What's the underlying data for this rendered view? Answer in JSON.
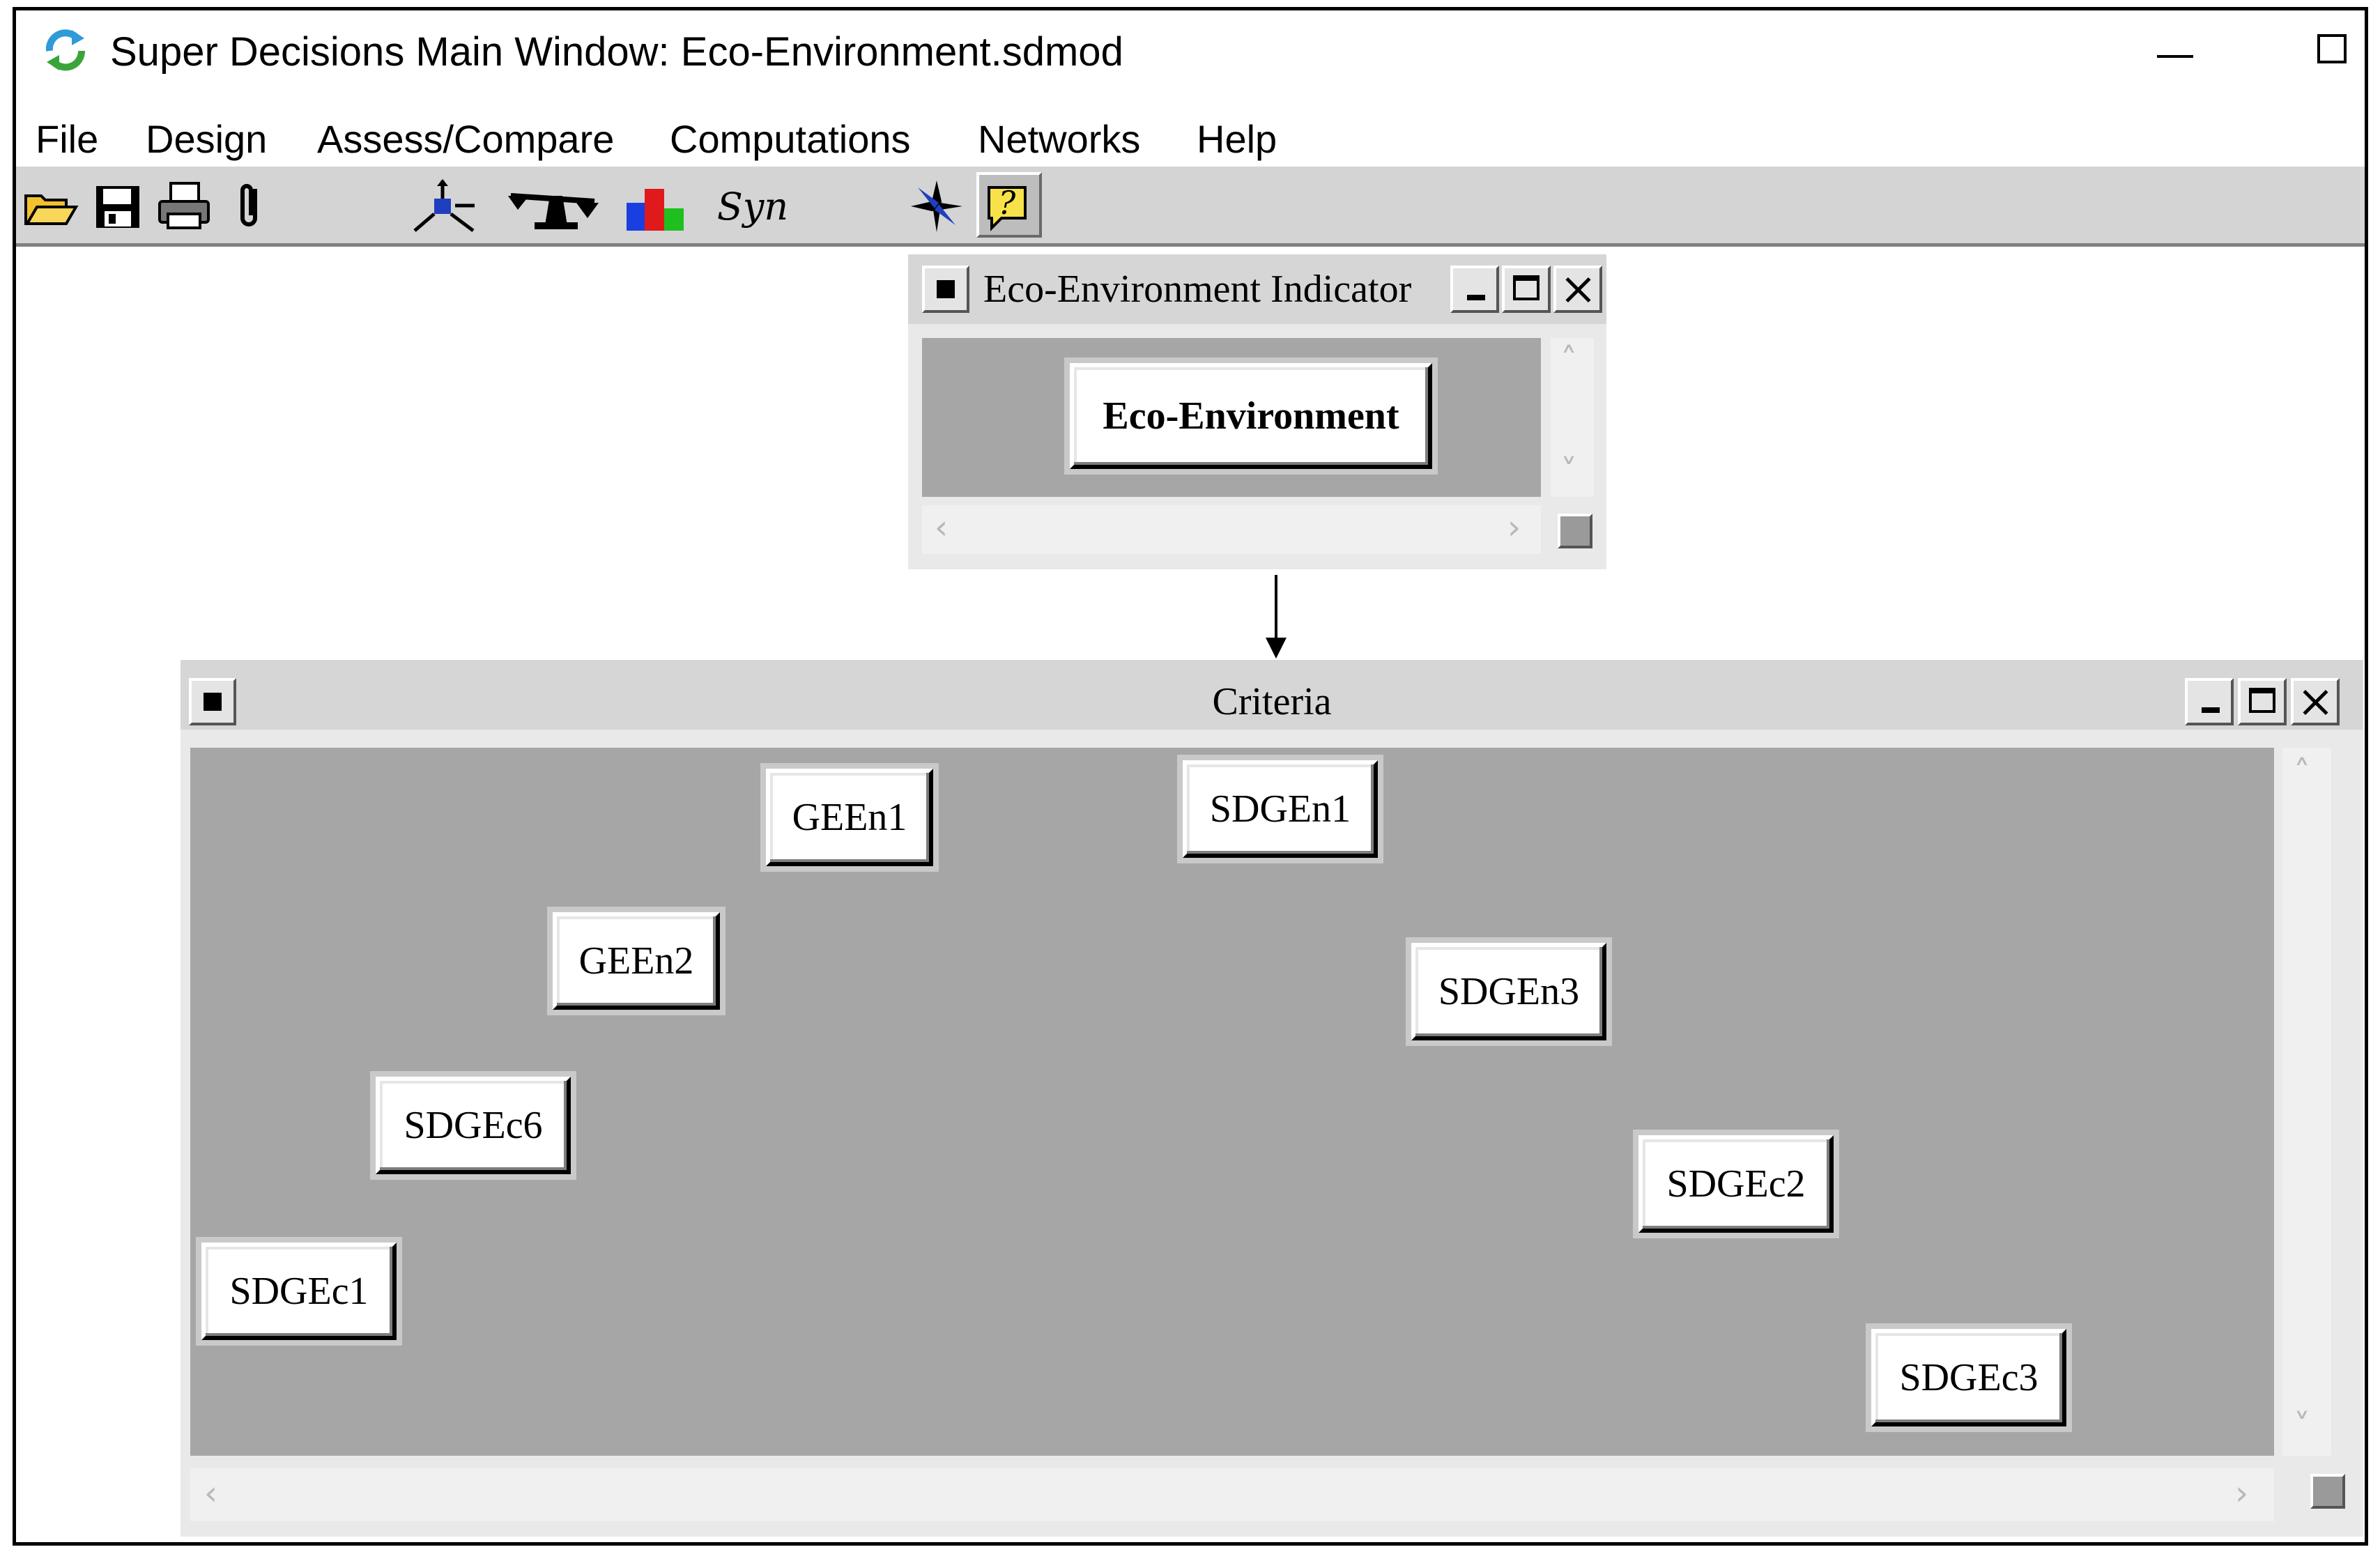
{
  "window": {
    "title": "Super Decisions Main Window: Eco-Environment.sdmod"
  },
  "menu": [
    "File",
    "Design",
    "Assess/Compare",
    "Computations",
    "Networks",
    "Help"
  ],
  "toolbar": {
    "syn_label": "Syn"
  },
  "clusters": [
    {
      "title": "Eco-Environment Indicator",
      "nodes": [
        {
          "label": "Eco-Environment"
        }
      ]
    },
    {
      "title": "Criteria",
      "nodes": [
        {
          "label": "GEEn1"
        },
        {
          "label": "SDGEn1"
        },
        {
          "label": "GEEn2"
        },
        {
          "label": "SDGEn3"
        },
        {
          "label": "SDGEc6"
        },
        {
          "label": "SDGEc2"
        },
        {
          "label": "SDGEc1"
        },
        {
          "label": "SDGEc3"
        }
      ]
    }
  ],
  "colors": {
    "canvas_gray": "#a6a6a6",
    "toolbar_gray": "#d4d4d4"
  }
}
